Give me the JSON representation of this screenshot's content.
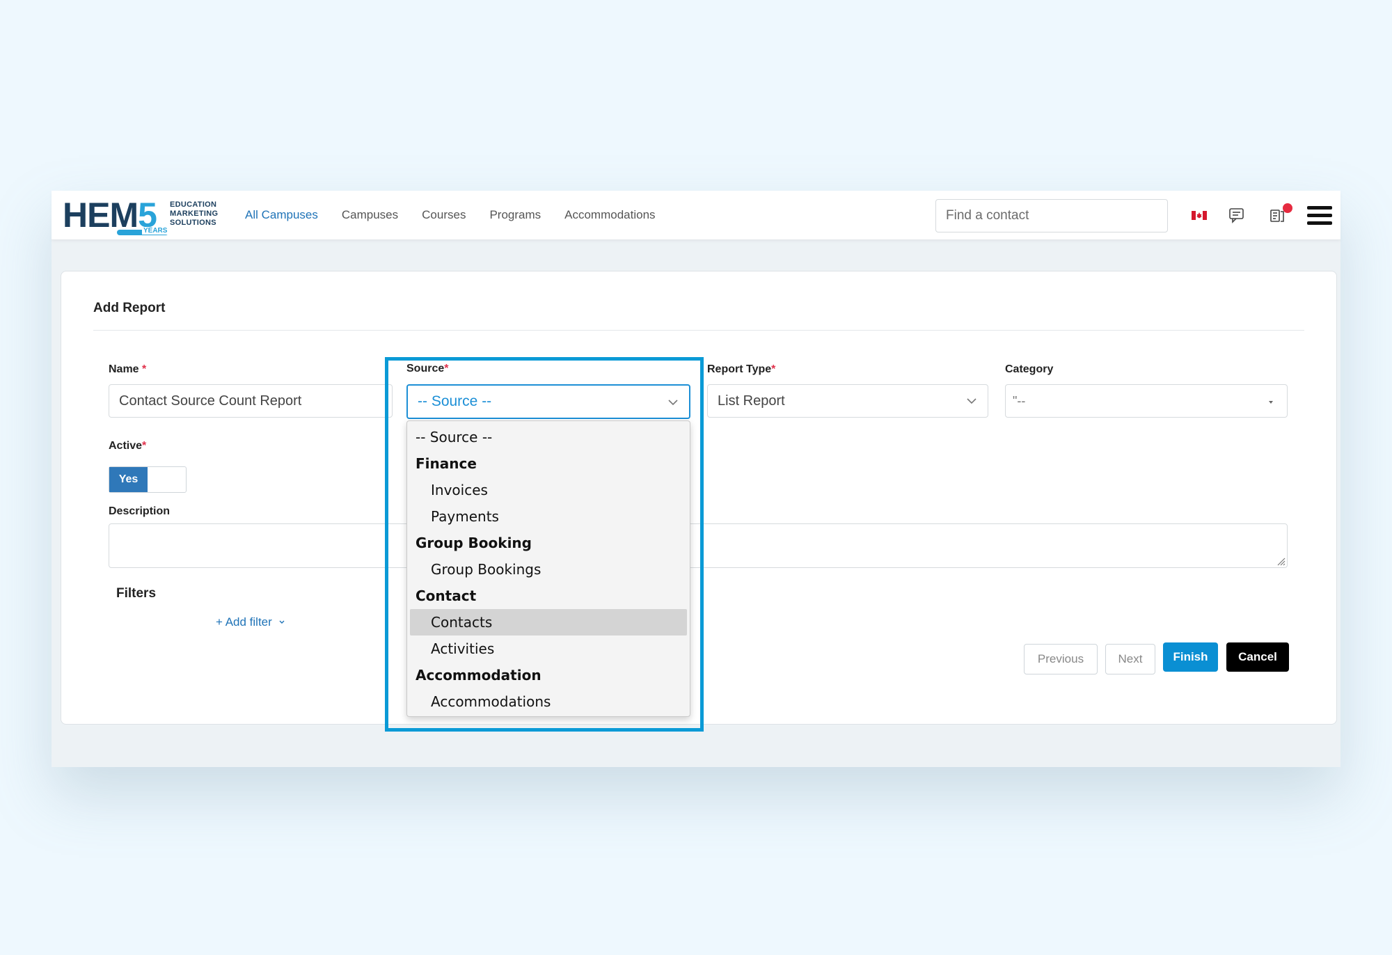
{
  "logo": {
    "big_text": "HEM",
    "big_number": "5",
    "lines": [
      "EDUCATION",
      "MARKETING",
      "SOLUTIONS"
    ],
    "years": "YEARS"
  },
  "nav": [
    {
      "label": "All Campuses",
      "active": true
    },
    {
      "label": "Campuses",
      "active": false
    },
    {
      "label": "Courses",
      "active": false
    },
    {
      "label": "Programs",
      "active": false
    },
    {
      "label": "Accommodations",
      "active": false
    }
  ],
  "search": {
    "placeholder": "Find a contact",
    "value": ""
  },
  "icons": {
    "flag": "canada-flag-icon",
    "chat": "chat-icon",
    "notifications": "notifications-icon",
    "menu": "hamburger-menu-icon"
  },
  "colors": {
    "accent": "#0a8fd3",
    "toggle_on": "#2f78b9",
    "required": "#e0314b",
    "highlight": "#0a9ad6"
  },
  "form": {
    "title": "Add Report",
    "name_label": "Name",
    "name_value": "Contact Source Count Report",
    "source_label": "Source",
    "source_value": "-- Source --",
    "report_type_label": "Report Type",
    "report_type_value": "List Report",
    "category_label": "Category",
    "category_value": "\"--",
    "active_label": "Active",
    "active_value": "Yes",
    "description_label": "Description",
    "filters_title": "Filters",
    "add_filter": "+ Add filter",
    "required_mark": "*"
  },
  "dropdown_options": [
    {
      "label": "-- Source --",
      "kind": "placeholder"
    },
    {
      "label": "Finance",
      "kind": "group"
    },
    {
      "label": "Invoices",
      "kind": "child"
    },
    {
      "label": "Payments",
      "kind": "child"
    },
    {
      "label": "Group Booking",
      "kind": "group"
    },
    {
      "label": "Group Bookings",
      "kind": "child"
    },
    {
      "label": "Contact",
      "kind": "group"
    },
    {
      "label": "Contacts",
      "kind": "child",
      "selected": true
    },
    {
      "label": "Activities",
      "kind": "child"
    },
    {
      "label": "Accommodation",
      "kind": "group"
    },
    {
      "label": "Accommodations",
      "kind": "child"
    }
  ],
  "buttons": {
    "previous": "Previous",
    "next": "Next",
    "finish": "Finish",
    "cancel": "Cancel"
  }
}
